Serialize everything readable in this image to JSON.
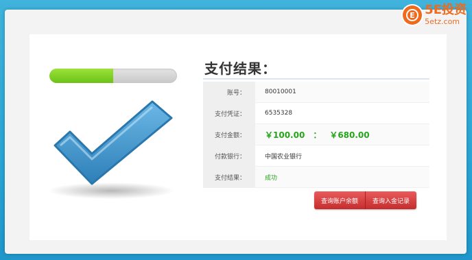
{
  "watermark": {
    "brand": "5E投资",
    "url": "5etz.com"
  },
  "progress": {
    "fraction": 0.5
  },
  "result": {
    "title": "支付结果：",
    "rows": [
      {
        "label": "账号：",
        "value": "80010001"
      },
      {
        "label": "支付凭证：",
        "value": "6535328"
      },
      {
        "label": "支付金额：",
        "amount1": "￥100.00",
        "sep": "：",
        "amount2": "￥680.00"
      },
      {
        "label": "付款银行：",
        "value": "中国农业银行"
      },
      {
        "label": "支付结果：",
        "value": "成功"
      }
    ]
  },
  "actions": {
    "balance_label": "查询账户余额",
    "deposit_label": "查询入金记录"
  },
  "colors": {
    "accent_green": "#25a51a",
    "button_red": "#d23a3a",
    "check_blue": "#3a8fc8"
  }
}
